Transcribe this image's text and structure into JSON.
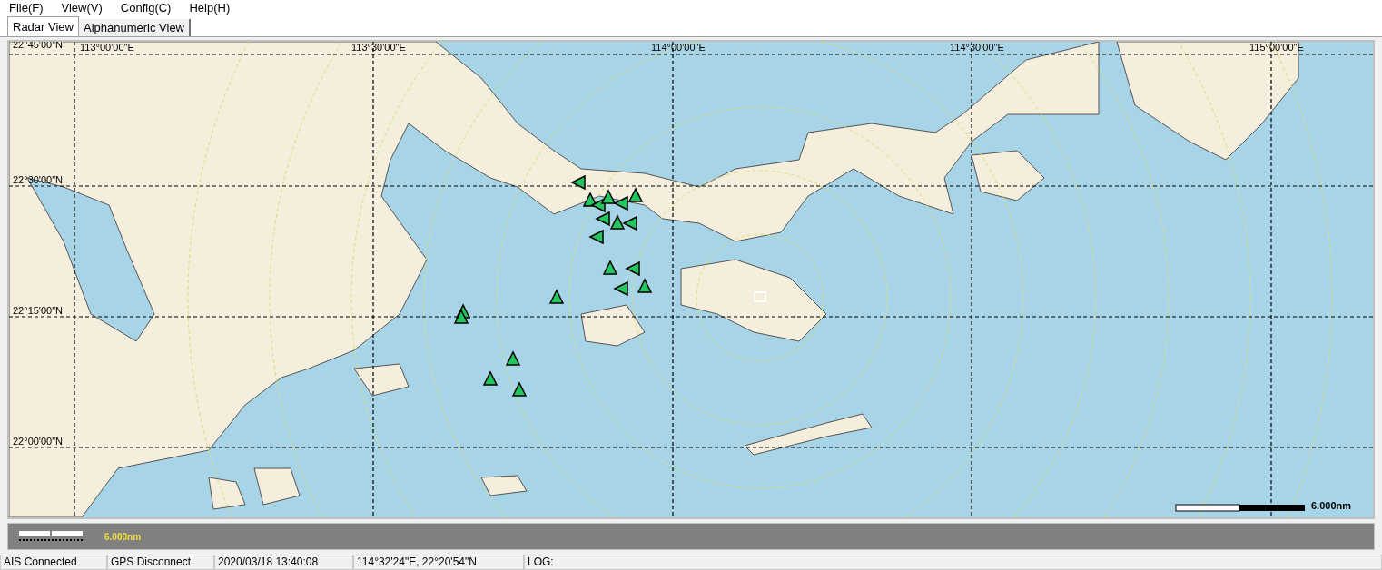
{
  "menu": [
    "File(F)",
    "View(V)",
    "Config(C)",
    "Help(H)"
  ],
  "tabs": [
    {
      "label": "Radar View",
      "selected": true
    },
    {
      "label": "Alphanumeric View",
      "selected": false
    }
  ],
  "map": {
    "longitude_labels": [
      "113°00'00\"E",
      "113°30'00\"E",
      "114°00'00\"E",
      "114°30'00\"E",
      "115°00'00\"E"
    ],
    "latitude_labels": [
      "22°45'00\"N",
      "22°30'00\"N",
      "22°15'00\"N",
      "22°00'00\"N"
    ],
    "scale": "6.000nm"
  },
  "bottom_bar": {
    "scale": "6.000nm"
  },
  "status_bar": [
    "AIS Connected",
    "GPS Disconnect",
    "2020/03/18 13:40:08",
    "114°32'24\"E, 22°20'54\"N",
    "LOG:"
  ]
}
